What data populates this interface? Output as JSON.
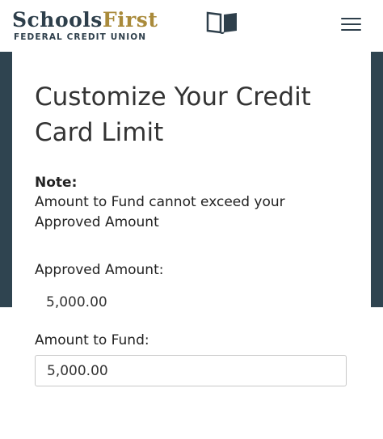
{
  "header": {
    "logo": {
      "word1": "Schools",
      "word2": "First",
      "subtitle": "FEDERAL CREDIT UNION"
    },
    "menu_icon": "hamburger-icon"
  },
  "card": {
    "title": "Customize Your Credit Card Limit",
    "note_heading": "Note:",
    "note_text": "Amount to Fund cannot exceed your Approved Amount",
    "approved_label": "Approved Amount:",
    "approved_value": "5,000.00",
    "fund_label": "Amount to Fund:",
    "fund_value": "5,000.00"
  },
  "colors": {
    "brand_navy": "#2e3f4b",
    "brand_gold": "#a98a3a",
    "band": "#2f4450"
  }
}
